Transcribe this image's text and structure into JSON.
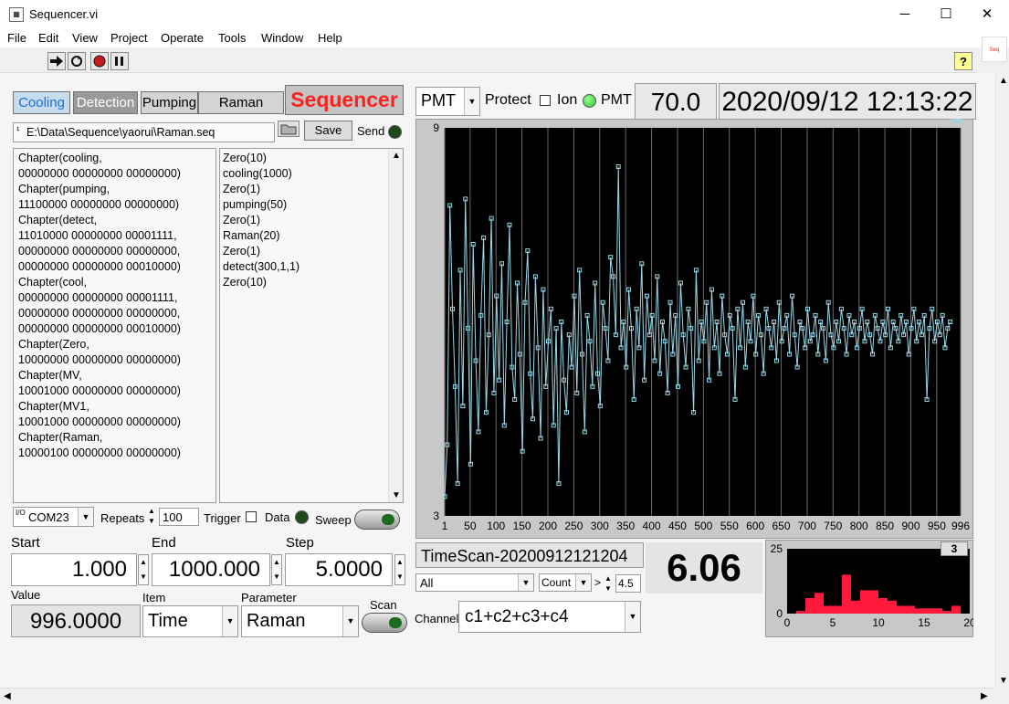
{
  "window": {
    "title": "Sequencer.vi",
    "minimize": "─",
    "maximize": "☐",
    "close": "✕"
  },
  "menu": [
    "File",
    "Edit",
    "View",
    "Project",
    "Operate",
    "Tools",
    "Window",
    "Help"
  ],
  "tabs": {
    "cooling": "Cooling",
    "detection": "Detection",
    "pumping": "Pumping",
    "raman": "Raman",
    "sequencer": "Sequencer"
  },
  "file": {
    "path": "E:\\Data\\Sequence\\yaorui\\Raman.seq",
    "save_label": "Save",
    "send_label": "Send"
  },
  "chapters_text": "Chapter(cooling,\n00000000 00000000 00000000)\nChapter(pumping,\n11100000 00000000 00000000)\nChapter(detect,\n11010000 00000000 00001111,\n00000000 00000000 00000000,\n00000000 00000000 00010000)\nChapter(cool,\n00000000 00000000 00001111,\n00000000 00000000 00000000,\n00000000 00000000 00010000)\nChapter(Zero,\n10000000 00000000 00000000)\nChapter(MV,\n10001000 00000000 00000000)\nChapter(MV1,\n10001000 00000000 00000000)\nChapter(Raman,\n10000100 00000000 00000000)",
  "sequence_text": "Zero(10)\ncooling(1000)\nZero(1)\npumping(50)\nZero(1)\nRaman(20)\nZero(1)\ndetect(300,1,1)\nZero(10)",
  "controls": {
    "com_port": "COM23",
    "com_prefix": "I/O",
    "repeats_label": "Repeats",
    "repeats": "100",
    "trigger_label": "Trigger",
    "data_label": "Data",
    "sweep_label": "Sweep",
    "start_label": "Start",
    "start": "1.000",
    "end_label": "End",
    "end": "1000.000",
    "step_label": "Step",
    "step": "5.0000",
    "value_label": "Value",
    "value": "996.0000",
    "item_label": "Item",
    "item": "Time",
    "parameter_label": "Parameter",
    "parameter": "Raman",
    "scan_label": "Scan"
  },
  "status": {
    "pmt_select": "PMT",
    "protect_label": "Protect",
    "ion_label": "Ion",
    "pmt_label": "PMT",
    "pmt_value": "70.0",
    "datetime": "2020/09/12 12:13:22"
  },
  "lower": {
    "scan_name": "TimeScan-20200912121204",
    "big_value": "6.06",
    "filter_all": "All",
    "count_label": "Count",
    "gt": ">",
    "threshold": "4.5",
    "channel_label": "Channel",
    "channel": "c1+c2+c3+c4",
    "hist_tag": "3"
  },
  "colors": {
    "plot_bg": "#000000",
    "trace": "#9ad8e8",
    "grid": "#6a6a6a",
    "hist_bar": "#ff1a3c",
    "sequencer_text": "#ff2020",
    "led_green": "#3cd23c"
  },
  "chart_data": [
    {
      "type": "line",
      "title": "",
      "xlim": [
        1,
        996
      ],
      "ylim": [
        3,
        9
      ],
      "x_ticks": [
        1,
        50,
        100,
        150,
        200,
        250,
        300,
        350,
        400,
        450,
        500,
        550,
        600,
        650,
        700,
        750,
        800,
        850,
        900,
        950,
        996
      ],
      "y_ticks": [
        3,
        9
      ],
      "grid": "vertical",
      "x": [
        1,
        6,
        11,
        16,
        21,
        26,
        31,
        36,
        41,
        46,
        51,
        56,
        61,
        66,
        71,
        76,
        81,
        86,
        91,
        96,
        101,
        106,
        111,
        116,
        121,
        126,
        131,
        136,
        141,
        146,
        151,
        156,
        161,
        166,
        171,
        176,
        181,
        186,
        191,
        196,
        201,
        206,
        211,
        216,
        221,
        226,
        231,
        236,
        241,
        246,
        251,
        256,
        261,
        266,
        271,
        276,
        281,
        286,
        291,
        296,
        301,
        306,
        311,
        316,
        321,
        326,
        331,
        336,
        341,
        346,
        351,
        356,
        361,
        366,
        371,
        376,
        381,
        386,
        391,
        396,
        401,
        406,
        411,
        416,
        421,
        426,
        431,
        436,
        441,
        446,
        451,
        456,
        461,
        466,
        471,
        476,
        481,
        486,
        491,
        496,
        501,
        506,
        511,
        516,
        521,
        526,
        531,
        536,
        541,
        546,
        551,
        556,
        561,
        566,
        571,
        576,
        581,
        586,
        591,
        596,
        601,
        606,
        611,
        616,
        621,
        626,
        631,
        636,
        641,
        646,
        651,
        656,
        661,
        666,
        671,
        676,
        681,
        686,
        691,
        696,
        701,
        706,
        711,
        716,
        721,
        726,
        731,
        736,
        741,
        746,
        751,
        756,
        761,
        766,
        771,
        776,
        781,
        786,
        791,
        796,
        801,
        806,
        811,
        816,
        821,
        826,
        831,
        836,
        841,
        846,
        851,
        856,
        861,
        866,
        871,
        876,
        881,
        886,
        891,
        896,
        901,
        906,
        911,
        916,
        921,
        926,
        931,
        936,
        941,
        946,
        951,
        956,
        961,
        966,
        971,
        976,
        981,
        986,
        991,
        996
      ],
      "values": [
        3.3,
        4.1,
        7.8,
        6.2,
        5.0,
        3.5,
        6.8,
        4.7,
        7.9,
        5.9,
        3.8,
        7.2,
        5.4,
        4.3,
        6.1,
        7.3,
        4.6,
        5.8,
        7.6,
        4.9,
        6.4,
        5.1,
        6.9,
        4.4,
        6.0,
        7.5,
        5.3,
        4.8,
        6.6,
        5.5,
        4.0,
        6.3,
        7.1,
        5.2,
        4.5,
        6.7,
        5.6,
        4.2,
        6.5,
        5.0,
        5.7,
        6.2,
        4.4,
        5.9,
        3.5,
        6.0,
        5.1,
        4.6,
        5.8,
        5.3,
        6.4,
        4.9,
        6.8,
        5.5,
        4.3,
        6.1,
        5.7,
        5.0,
        6.6,
        5.2,
        4.7,
        6.3,
        5.9,
        5.4,
        7.0,
        6.7,
        5.8,
        8.4,
        5.6,
        6.0,
        5.3,
        6.5,
        5.9,
        4.8,
        6.2,
        5.6,
        6.9,
        5.1,
        6.4,
        5.8,
        6.1,
        5.4,
        6.7,
        5.2,
        6.0,
        5.7,
        4.9,
        6.3,
        5.5,
        6.1,
        5.0,
        6.6,
        5.8,
        5.3,
        6.2,
        5.9,
        4.6,
        6.8,
        5.4,
        6.0,
        5.7,
        6.3,
        5.1,
        6.5,
        5.6,
        6.0,
        5.2,
        6.4,
        5.8,
        5.5,
        6.1,
        5.9,
        4.8,
        6.2,
        5.6,
        6.3,
        5.3,
        6.0,
        5.7,
        6.4,
        5.5,
        6.1,
        5.8,
        5.2,
        6.2,
        5.9,
        5.6,
        6.0,
        5.4,
        6.3,
        5.7,
        5.9,
        6.1,
        5.5,
        6.4,
        5.8,
        5.3,
        6.0,
        5.9,
        5.6,
        6.2,
        5.7,
        5.8,
        6.1,
        5.5,
        6.0,
        5.9,
        5.4,
        6.3,
        5.8,
        5.6,
        6.0,
        5.7,
        6.2,
        5.9,
        5.5,
        6.1,
        5.8,
        6.0,
        5.6,
        5.9,
        6.2,
        5.7,
        6.0,
        5.8,
        5.5,
        6.1,
        5.9,
        5.7,
        6.0,
        5.8,
        6.2,
        5.6,
        6.0,
        5.9,
        5.7,
        6.1,
        5.8,
        6.0,
        5.5,
        5.9,
        6.2,
        5.7,
        6.0,
        5.8,
        6.1,
        4.8,
        5.9,
        6.2,
        5.7,
        6.0,
        5.8,
        6.1,
        5.6,
        5.9,
        6.0
      ]
    },
    {
      "type": "bar",
      "title": "",
      "xlim": [
        0,
        20
      ],
      "ylim": [
        0,
        25
      ],
      "x_ticks": [
        0,
        5,
        10,
        15,
        20
      ],
      "y_ticks": [
        0,
        25
      ],
      "x": [
        0,
        1,
        2,
        3,
        4,
        5,
        6,
        7,
        8,
        9,
        10,
        11,
        12,
        13,
        14,
        15,
        16,
        17,
        18,
        19
      ],
      "values": [
        0,
        1,
        6,
        8,
        3,
        3,
        15,
        5,
        9,
        9,
        6,
        5,
        3,
        3,
        2,
        2,
        2,
        1,
        3,
        0
      ]
    }
  ]
}
